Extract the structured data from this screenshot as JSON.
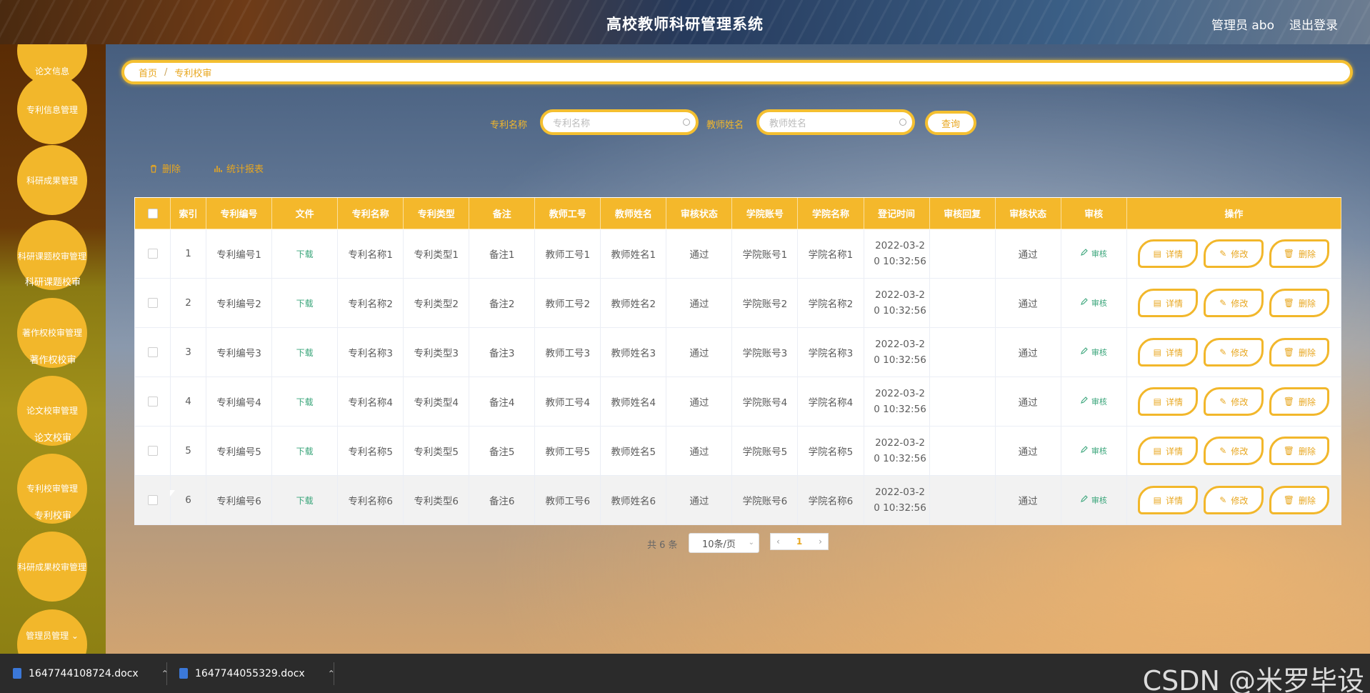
{
  "header": {
    "title": "高校教师科研管理系统",
    "user": "管理员 abo",
    "logout": "退出登录"
  },
  "sidebar": {
    "circles": [
      {
        "label": "论文信息"
      },
      {
        "label": "专利信息管理"
      },
      {
        "label": "科研成果管理"
      },
      {
        "label": "科研课题校审管理",
        "sub": "科研课题校审"
      },
      {
        "label": "著作权校审管理",
        "sub": "著作权校审"
      },
      {
        "label": "论文校审管理",
        "sub": "论文校审"
      },
      {
        "label": "专利校审管理",
        "sub": "专利校审"
      },
      {
        "label": "科研成果校审管理"
      },
      {
        "label": "管理员管理 ⌄"
      }
    ]
  },
  "breadcrumb": {
    "home": "首页",
    "sep": "/",
    "current": "专利校审"
  },
  "search": {
    "patent_label": "专利名称",
    "patent_placeholder": "专利名称",
    "teacher_label": "教师姓名",
    "teacher_placeholder": "教师姓名",
    "query_button": "查询"
  },
  "actions": {
    "delete": "删除",
    "report": "统计报表"
  },
  "table": {
    "headers": [
      "",
      "索引",
      "专利编号",
      "文件",
      "专利名称",
      "专利类型",
      "备注",
      "教师工号",
      "教师姓名",
      "审核状态",
      "学院账号",
      "学院名称",
      "登记时间",
      "审核回复",
      "审核状态",
      "审核",
      "操作"
    ],
    "download_label": "下载",
    "audit_label": "审核",
    "op_labels": {
      "detail": "详情",
      "edit": "修改",
      "delete": "删除"
    },
    "rows": [
      {
        "idx": "1",
        "no": "专利编号1",
        "name": "专利名称1",
        "type": "专利类型1",
        "note": "备注1",
        "tno": "教师工号1",
        "tname": "教师姓名1",
        "status": "通过",
        "college_acct": "学院账号1",
        "college_name": "学院名称1",
        "time1": "2022-03-2",
        "time2": "0 10:32:56",
        "reply": "",
        "status2": "通过"
      },
      {
        "idx": "2",
        "no": "专利编号2",
        "name": "专利名称2",
        "type": "专利类型2",
        "note": "备注2",
        "tno": "教师工号2",
        "tname": "教师姓名2",
        "status": "通过",
        "college_acct": "学院账号2",
        "college_name": "学院名称2",
        "time1": "2022-03-2",
        "time2": "0 10:32:56",
        "reply": "",
        "status2": "通过"
      },
      {
        "idx": "3",
        "no": "专利编号3",
        "name": "专利名称3",
        "type": "专利类型3",
        "note": "备注3",
        "tno": "教师工号3",
        "tname": "教师姓名3",
        "status": "通过",
        "college_acct": "学院账号3",
        "college_name": "学院名称3",
        "time1": "2022-03-2",
        "time2": "0 10:32:56",
        "reply": "",
        "status2": "通过"
      },
      {
        "idx": "4",
        "no": "专利编号4",
        "name": "专利名称4",
        "type": "专利类型4",
        "note": "备注4",
        "tno": "教师工号4",
        "tname": "教师姓名4",
        "status": "通过",
        "college_acct": "学院账号4",
        "college_name": "学院名称4",
        "time1": "2022-03-2",
        "time2": "0 10:32:56",
        "reply": "",
        "status2": "通过"
      },
      {
        "idx": "5",
        "no": "专利编号5",
        "name": "专利名称5",
        "type": "专利类型5",
        "note": "备注5",
        "tno": "教师工号5",
        "tname": "教师姓名5",
        "status": "通过",
        "college_acct": "学院账号5",
        "college_name": "学院名称5",
        "time1": "2022-03-2",
        "time2": "0 10:32:56",
        "reply": "",
        "status2": "通过"
      },
      {
        "idx": "6",
        "no": "专利编号6",
        "name": "专利名称6",
        "type": "专利类型6",
        "note": "备注6",
        "tno": "教师工号6",
        "tname": "教师姓名6",
        "status": "通过",
        "college_acct": "学院账号6",
        "college_name": "学院名称6",
        "time1": "2022-03-2",
        "time2": "0 10:32:56",
        "reply": "",
        "status2": "通过"
      }
    ]
  },
  "pagination": {
    "total": "共 6 条",
    "page_size": "10条/页",
    "current_page": "1"
  },
  "taskbar": {
    "file1": "1647744108724.docx",
    "file2": "1647744055329.docx",
    "watermark": "CSDN @米罗毕设"
  },
  "colors": {
    "accent": "#f2b72b",
    "link_green": "#3aa57a"
  }
}
